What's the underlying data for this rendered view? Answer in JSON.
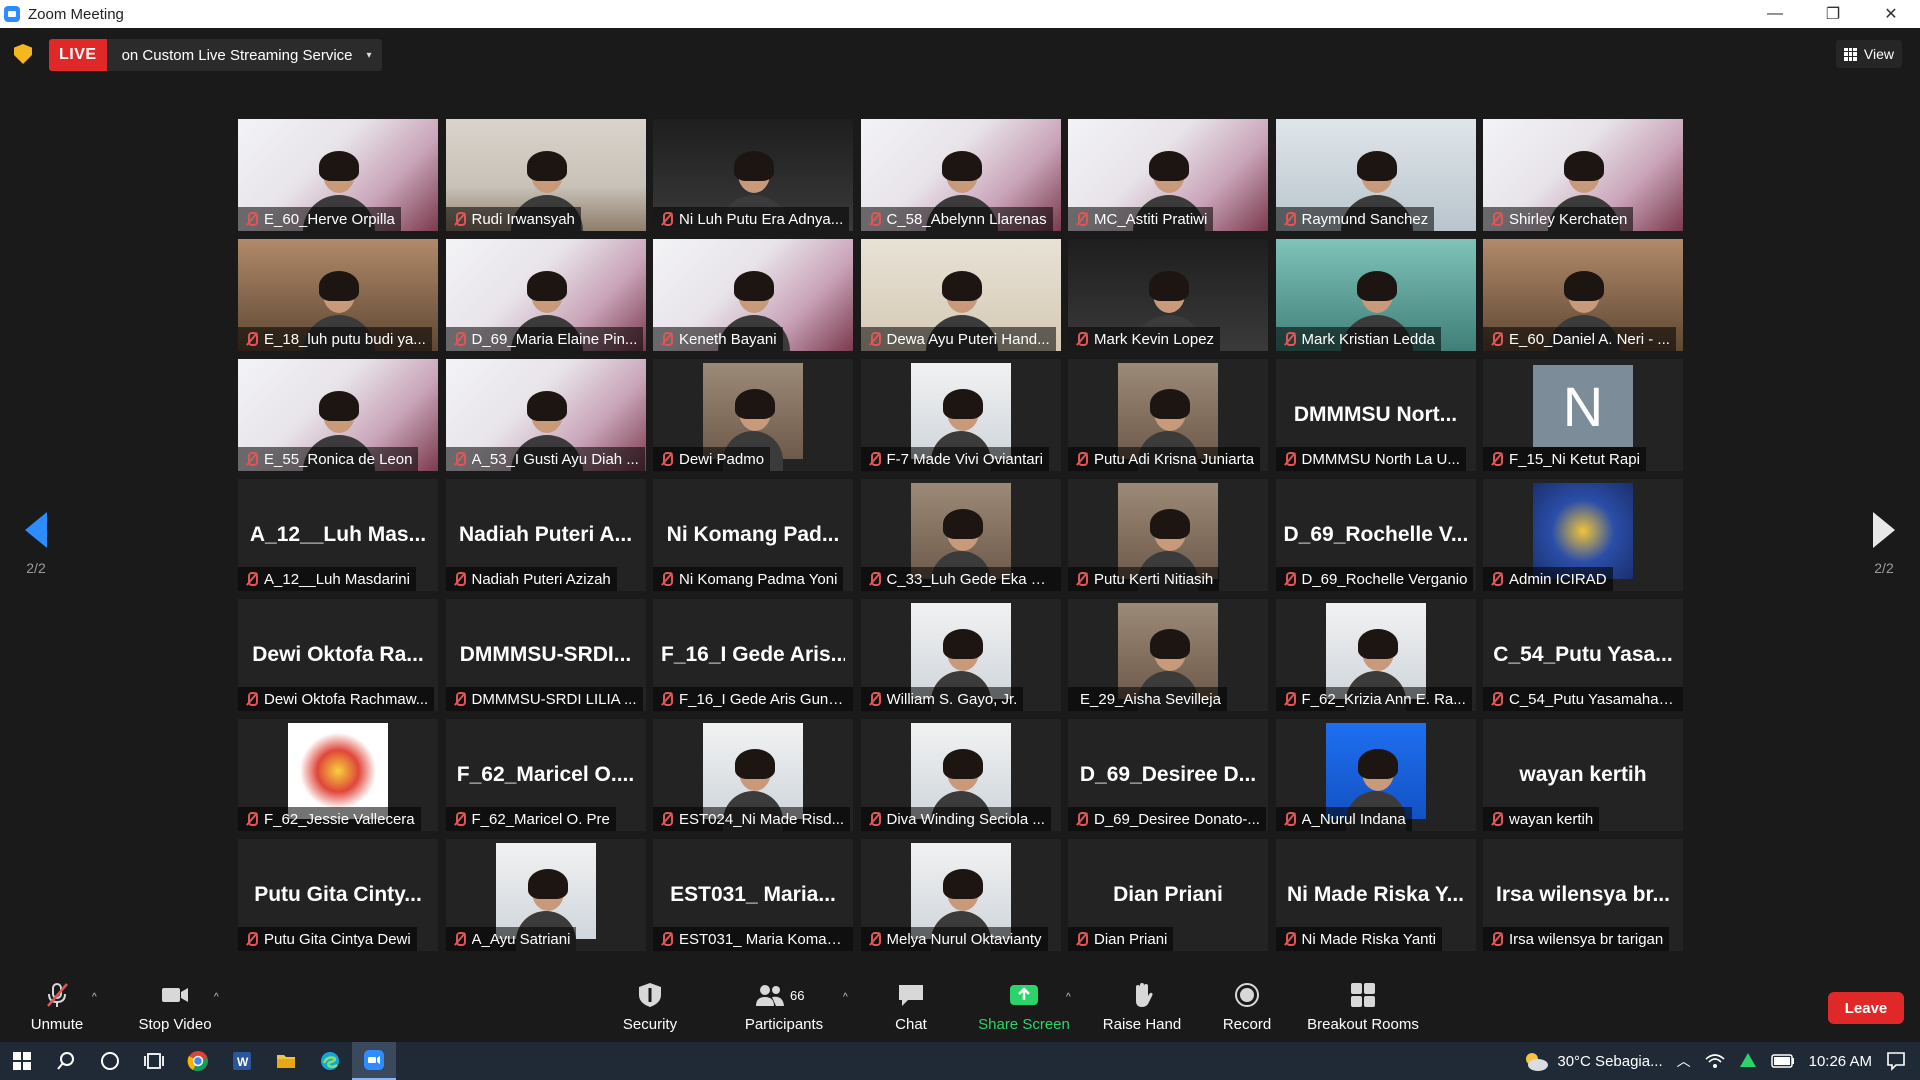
{
  "window": {
    "title": "Zoom Meeting",
    "minimize_glyph": "—",
    "restore_glyph": "❐",
    "close_glyph": "✕"
  },
  "topbar": {
    "live_badge": "LIVE",
    "live_service": "on Custom Live Streaming Service",
    "caret": "▾",
    "view_label": "View"
  },
  "paging": {
    "left_label": "2/2",
    "right_label": "2/2"
  },
  "participants": [
    {
      "name": "E_60_Herve Orpilla",
      "bg": "conf"
    },
    {
      "name": "Rudi Irwansyah",
      "bg": "office"
    },
    {
      "name": "Ni Luh Putu Era Adnya...",
      "bg": "dark"
    },
    {
      "name": "C_58_Abelynn Llarenas",
      "bg": "conf"
    },
    {
      "name": "MC_Astiti Pratiwi",
      "bg": "conf"
    },
    {
      "name": "Raymund Sanchez",
      "bg": "wall"
    },
    {
      "name": "Shirley Kerchaten",
      "bg": "conf"
    },
    {
      "name": "E_18_luh putu budi ya...",
      "bg": "warm"
    },
    {
      "name": "D_69_Maria Elaine Pin...",
      "bg": "conf"
    },
    {
      "name": "Keneth Bayani",
      "bg": "conf"
    },
    {
      "name": "Dewa Ayu Puteri Hand...",
      "bg": "room"
    },
    {
      "name": "Mark Kevin Lopez",
      "bg": "dark"
    },
    {
      "name": "Mark Kristian Ledda",
      "bg": "teal"
    },
    {
      "name": "E_60_Daniel A. Neri - ...",
      "bg": "warm"
    },
    {
      "name": "E_55_Ronica de Leon",
      "bg": "conf"
    },
    {
      "name": "A_53_I Gusti Ayu Diah ...",
      "bg": "conf"
    },
    {
      "name": "Dewi Padmo",
      "avatar": "photo"
    },
    {
      "name": "F-7 Made Vivi Oviantari",
      "avatar": "photo-light"
    },
    {
      "name": "Putu Adi Krisna Juniarta",
      "avatar": "photo"
    },
    {
      "name": "DMMMSU North La U...",
      "big": "DMMMSU  Nort..."
    },
    {
      "name": "F_15_Ni Ketut Rapi",
      "initial": "N"
    },
    {
      "name": "A_12__Luh Masdarini",
      "big": "A_12__Luh  Mas..."
    },
    {
      "name": "Nadiah Puteri Azizah",
      "big": "Nadiah  Puteri  A..."
    },
    {
      "name": "Ni Komang Padma Yoni",
      "big": "Ni  Komang  Pad..."
    },
    {
      "name": "C_33_Luh Gede Eka W...",
      "avatar": "photo"
    },
    {
      "name": "Putu Kerti Nitiasih",
      "avatar": "photo"
    },
    {
      "name": "D_69_Rochelle Verganio",
      "big": "D_69_Rochelle  V..."
    },
    {
      "name": "Admin ICIRAD",
      "avatar": "logo-blue"
    },
    {
      "name": "Dewi Oktofa Rachmaw...",
      "big": "Dewi  Oktofa  Ra..."
    },
    {
      "name": "DMMMSU-SRDI LILIA ...",
      "big": "DMMMSU-SRDI..."
    },
    {
      "name": "F_16_I Gede Aris Guna...",
      "big": "F_16_I  Gede  Aris..."
    },
    {
      "name": "William S. Gayo, Jr.",
      "avatar": "photo-light"
    },
    {
      "name": "E_29_Aisha Sevilleja",
      "avatar": "photo",
      "unmuted": true
    },
    {
      "name": "F_62_Krizia Ann E. Ra...",
      "avatar": "photo-light"
    },
    {
      "name": "C_54_Putu Yasamahad...",
      "big": "C_54_Putu  Yasa..."
    },
    {
      "name": "F_62_Jessie Vallecera",
      "avatar": "logo-white"
    },
    {
      "name": "F_62_Maricel O. Pre",
      "big": "F_62_Maricel  O...."
    },
    {
      "name": "EST024_Ni Made Risd...",
      "avatar": "photo-light"
    },
    {
      "name": "Diva Winding Seciola ...",
      "avatar": "photo-light"
    },
    {
      "name": "D_69_Desiree Donato-...",
      "big": "D_69_Desiree  D..."
    },
    {
      "name": "A_Nurul Indana",
      "avatar": "photo-blue"
    },
    {
      "name": "wayan kertih",
      "big": "wayan  kertih"
    },
    {
      "name": "Putu Gita Cintya Dewi",
      "big": "Putu  Gita  Cinty..."
    },
    {
      "name": "A_Ayu Satriani",
      "avatar": "photo-light"
    },
    {
      "name": "EST031_ Maria Koman...",
      "big": "EST031_  Maria..."
    },
    {
      "name": "Melya Nurul Oktavianty",
      "avatar": "photo-light"
    },
    {
      "name": "Dian Priani",
      "big": "Dian  Priani"
    },
    {
      "name": "Ni Made Riska Yanti",
      "big": "Ni  Made  Riska  Y..."
    },
    {
      "name": "Irsa wilensya br tarigan",
      "big": "Irsa  wilensya  br..."
    }
  ],
  "toolbar": {
    "unmute": "Unmute",
    "stop_video": "Stop Video",
    "security": "Security",
    "participants": "Participants",
    "participants_count": "66",
    "chat": "Chat",
    "share_screen": "Share Screen",
    "raise_hand": "Raise Hand",
    "record": "Record",
    "breakout_rooms": "Breakout Rooms",
    "leave": "Leave",
    "caret": "^"
  },
  "taskbar": {
    "weather": "30°C  Sebagia...",
    "time": "10:26 AM"
  },
  "colors": {
    "accent": "#2d8cff",
    "live": "#e02828",
    "share_green": "#2bd36a",
    "mute_red": "#e05555"
  }
}
